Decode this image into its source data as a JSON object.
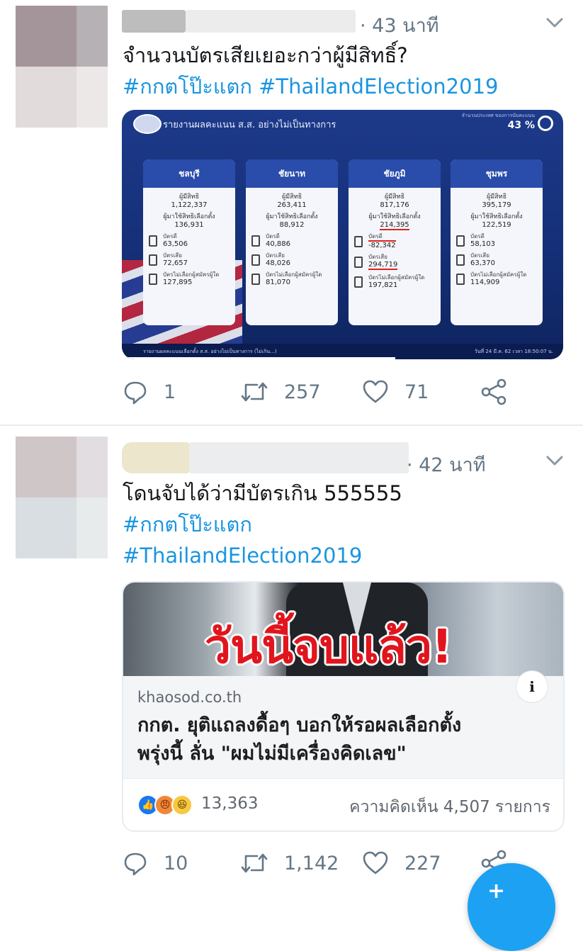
{
  "colors": {
    "accent": "#1b95e0",
    "secondary_text": "#657786",
    "divider": "#e6ecf0",
    "fab": "#1da1f2"
  },
  "tweets": [
    {
      "timestamp": "43 นาที",
      "text": "จำนวนบัตรเสียเยอะกว่าผู้มีสิทธิ์?",
      "hashtags": [
        "#กกตโป๊ะแตก",
        "#ThailandElection2019"
      ],
      "media": {
        "header": "รายงานผลคะแนน ส.ส. อย่างไม่เป็นทางการ",
        "progress_label": "จำนวนประเทศ ของการนับคะแนน",
        "progress_value": "43 %",
        "labels": {
          "eligible": "ผู้มีสิทธิ",
          "voters": "ผู้มาใช้สิทธิเลือกตั้ง",
          "good": "บัตรดี",
          "bad": "บัตรเสีย",
          "no_vote": "บัตรไม่เลือกผู้สมัครผู้ใด"
        },
        "provinces": [
          {
            "name": "ชลบุรี",
            "eligible": "1,122,337",
            "voters": "136,931",
            "good": "63,506",
            "bad": "72,657",
            "no_vote": "127,895"
          },
          {
            "name": "ชัยนาท",
            "eligible": "263,411",
            "voters": "88,912",
            "good": "40,886",
            "bad": "48,026",
            "no_vote": "81,070"
          },
          {
            "name": "ชัยภูมิ",
            "eligible": "817,176",
            "voters": "214,395",
            "good": "-82,342",
            "bad": "294,719",
            "no_vote": "197,821"
          },
          {
            "name": "ชุมพร",
            "eligible": "395,179",
            "voters": "122,519",
            "good": "58,103",
            "bad": "63,370",
            "no_vote": "114,909"
          }
        ],
        "footer_left": "รายงานผลคะแนนเลือกตั้ง ส.ส. อย่างไม่เป็นทางการ (ไม่เกิน...)",
        "footer_right": "วันที่ 24 มี.ค. 62 เวลา 18:50:07 น."
      },
      "actions": {
        "replies": "1",
        "retweets": "257",
        "likes": "71"
      }
    },
    {
      "timestamp": "42 นาที",
      "text": "โดนจับได้ว่ามีบัตรเกิน 555555",
      "hashtags": [
        "#กกตโป๊ะแตก",
        "#ThailandElection2019"
      ],
      "link_card": {
        "image_headline": "วันนี้จบแล้ว!",
        "domain": "khaosod.co.th",
        "title_line1": "กกต. ยุติแถลงดื้อๆ บอกให้รอผลเลือกตั้ง",
        "title_line2": "พรุ่งนี้ ลั่น \"ผมไม่มีเครื่องคิดเลข\"",
        "reaction_count": "13,363",
        "comments": "ความคิดเห็น 4,507 รายการ",
        "info_icon": "i"
      },
      "actions": {
        "replies": "10",
        "retweets": "1,142",
        "likes": "227"
      }
    }
  ],
  "fab_label": "+"
}
